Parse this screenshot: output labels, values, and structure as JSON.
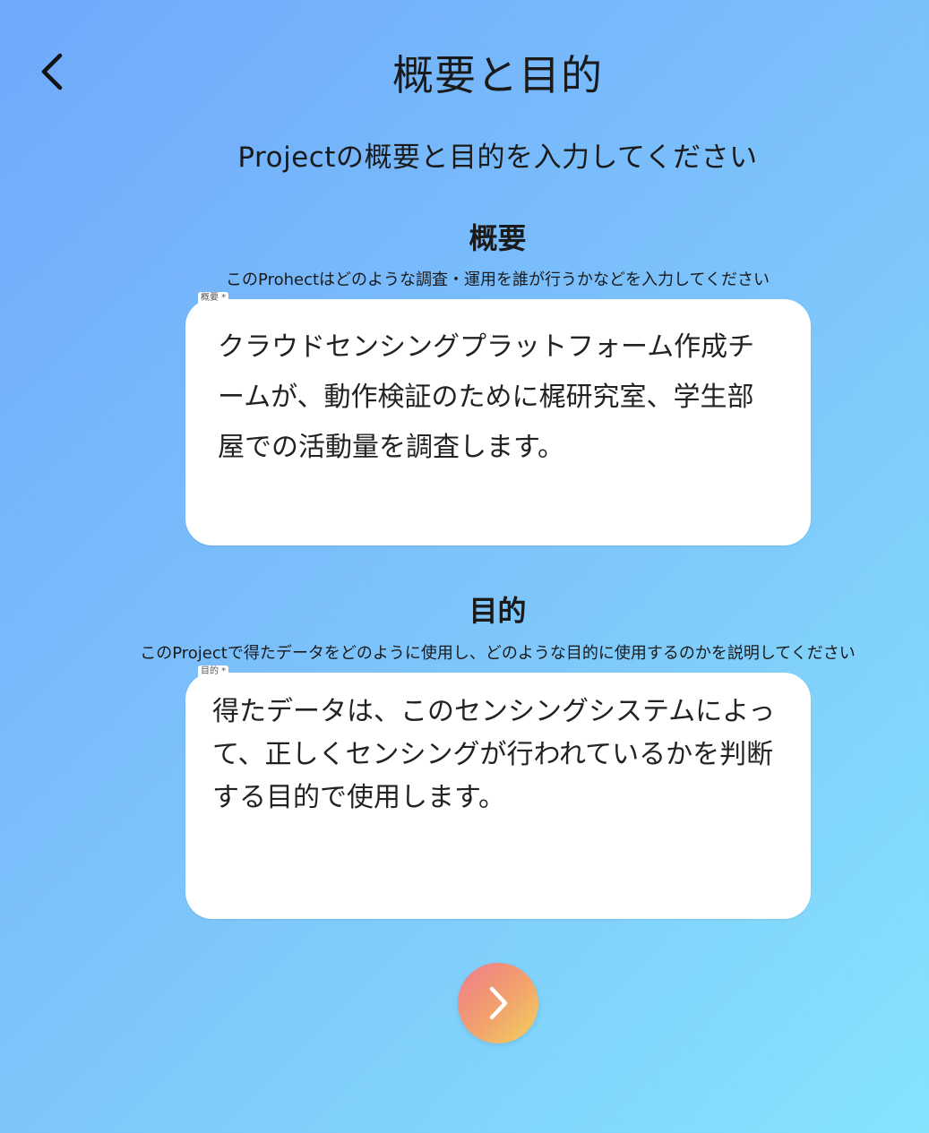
{
  "header": {
    "title": "概要と目的",
    "back_icon": "chevron-left-icon"
  },
  "subtitle": "Projectの概要と目的を入力してください",
  "overview": {
    "heading": "概要",
    "description": "このProhectはどのような調査・運用を誰が行うかなどを入力してください",
    "field_label": "概要 *",
    "value": "クラウドセンシングプラットフォーム作成チームが、動作検証のために梶研究室、学生部屋での活動量を調査します。"
  },
  "purpose": {
    "heading": "目的",
    "description": "このProjectで得たデータをどのように使用し、どのような目的に使用するのかを説明してください",
    "field_label": "目的 *",
    "value": "得たデータは、このセンシングシステムによって、正しくセンシングが行われているかを判断する目的で使用します。"
  },
  "footer": {
    "next_icon": "chevron-right-icon",
    "next_colors": [
      "#ee7b8a",
      "#f3d35c"
    ]
  },
  "colors": {
    "background_start": "#6fa9fb",
    "background_end": "#86e3fc",
    "field_background": "#ffffff"
  }
}
